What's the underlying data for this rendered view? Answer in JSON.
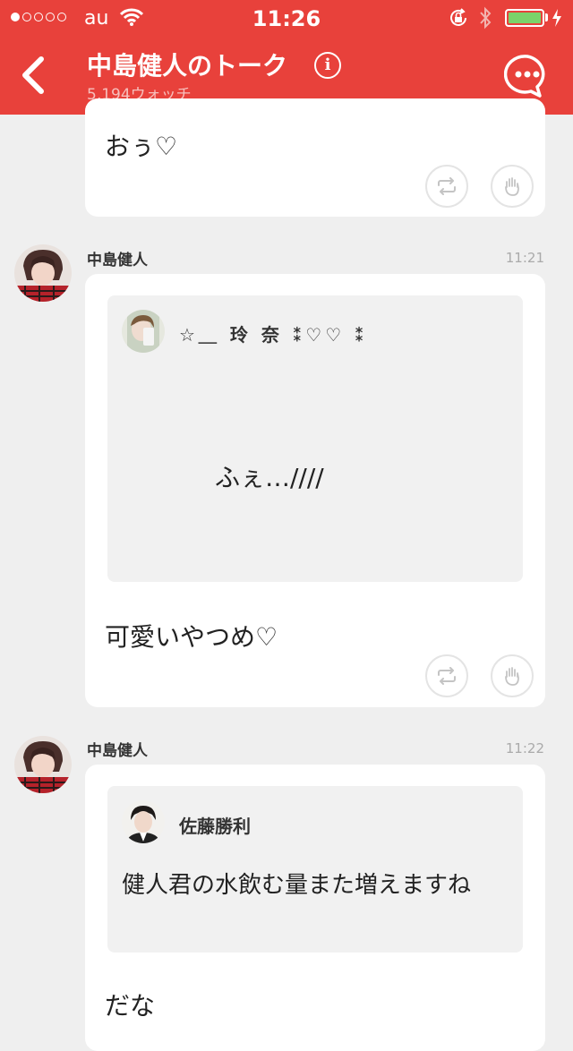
{
  "status_bar": {
    "carrier": "au",
    "time": "11:26"
  },
  "nav": {
    "title": "中島健人のトーク",
    "info_label": "i",
    "watch_count": "5,194ウォッチ"
  },
  "messages": [
    {
      "text": "おぅ♡"
    },
    {
      "author": "中島健人",
      "time": "11:21",
      "quote": {
        "author": "☆＿ 玲 奈 ⁑♡♡ ⁑",
        "text": "ふぇ…////"
      },
      "text": "可愛いやつめ♡"
    },
    {
      "author": "中島健人",
      "time": "11:22",
      "quote": {
        "author": "佐藤勝利",
        "text": "健人君の水飲む量また増えますね"
      },
      "text": "だな"
    }
  ],
  "colors": {
    "header": "#e8413b",
    "background": "#efefef",
    "battery": "#7ad36a"
  },
  "icons": [
    "back-arrow-icon",
    "info-icon",
    "chat-bubble-icon",
    "repost-icon",
    "cheer-hand-icon",
    "wifi-icon",
    "lock-rotation-icon",
    "bluetooth-icon",
    "battery-icon",
    "charging-icon"
  ]
}
